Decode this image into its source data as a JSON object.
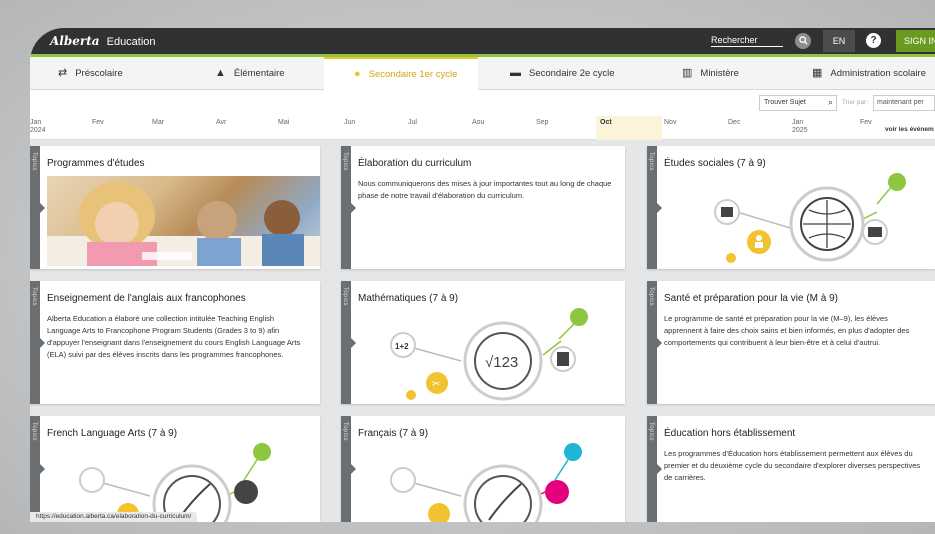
{
  "header": {
    "brand": "Education",
    "brand_logo": "Alberta",
    "search_label": "Rechercher",
    "lang": "EN",
    "help": "?",
    "signin": "SIGN IN",
    "accent_green": "#8dc63f"
  },
  "tabs": [
    {
      "label": "Préscolaire",
      "icon": "arrows-icon"
    },
    {
      "label": "Élémentaire",
      "icon": "person-reading-icon"
    },
    {
      "label": "Secondaire 1er cycle",
      "icon": "helmet-icon",
      "active": true
    },
    {
      "label": "Secondaire 2e cycle",
      "icon": "person-desk-icon"
    },
    {
      "label": "Ministère",
      "icon": "building-icon"
    },
    {
      "label": "Administration scolaire",
      "icon": "office-icon"
    }
  ],
  "filter": {
    "find_topic": "Trouver Sujet",
    "sort_label": "Trier par:",
    "sort_value": "maintenant per"
  },
  "timeline": {
    "months": [
      {
        "label": "Jan",
        "year": "2024"
      },
      {
        "label": "Fev"
      },
      {
        "label": "Mar"
      },
      {
        "label": "Avr"
      },
      {
        "label": "Mai"
      },
      {
        "label": "Jun"
      },
      {
        "label": "Jul"
      },
      {
        "label": "Aou"
      },
      {
        "label": "Sep"
      },
      {
        "label": "Oct",
        "current": true
      },
      {
        "label": "Nov"
      },
      {
        "label": "Dec"
      },
      {
        "label": "Jan",
        "year": "2025"
      },
      {
        "label": "Fev"
      }
    ],
    "see_events": "voir les événem"
  },
  "rail_label": "Topics",
  "cards": [
    {
      "title": "Programmes d'études",
      "type": "photo"
    },
    {
      "title": "Élaboration du curriculum",
      "body": "Nous communiquerons des mises à jour importantes tout au long de chaque phase de notre travail d'élaboration du curriculum."
    },
    {
      "title": "Études sociales (7 à 9)",
      "type": "icon-globe"
    },
    {
      "title": "Enseignement de l'anglais aux francophones",
      "body": "Alberta Education a élaboré une collection intitulée Teaching English Language Arts to Francophone Program Students (Grades 3 to 9) afin d'appuyer l'enseignant dans l'enseignement du cours English Language Arts (ELA) suivi par des élèves inscrits dans les programmes francophones."
    },
    {
      "title": "Mathématiques (7 à 9)",
      "type": "icon-math",
      "math_text": "√123",
      "bubble_text": "1+2"
    },
    {
      "title": "Santé et préparation pour la vie (M à 9)",
      "body": "Le programme de santé et préparation pour la vie (M–9), les élèves apprennent à faire des choix sains et bien informés, en plus d'adopter des comportements qui contribuent à leur bien-être et à celui d'autrui."
    },
    {
      "title": "French Language Arts (7 à 9)",
      "type": "icon-quill-green"
    },
    {
      "title": "Français (7 à 9)",
      "type": "icon-quill-pink"
    },
    {
      "title": "Éducation hors établissement",
      "body": "Les programmes d'Éducation hors établissement permettent aux élèves du premier et du deuxième cycle du secondaire d'explorer diverses perspectives de carrières."
    }
  ],
  "status_url": "https://education.alberta.ca/elaboration-du-curriculum/"
}
